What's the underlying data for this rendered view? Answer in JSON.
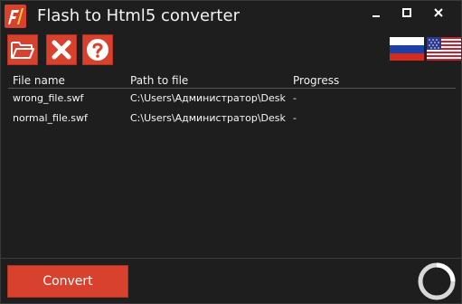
{
  "window": {
    "title": "Flash to Html5 converter",
    "logo_icon": "flash-converter-logo-icon",
    "controls": [
      "minimize-icon",
      "maximize-icon",
      "close-icon"
    ]
  },
  "toolbar": {
    "buttons": [
      {
        "icon": "folder-open-icon",
        "action": "open"
      },
      {
        "icon": "x-remove-icon",
        "action": "remove"
      },
      {
        "icon": "question-help-icon",
        "action": "help"
      }
    ],
    "languages": [
      "russian-flag-icon",
      "usa-flag-icon"
    ]
  },
  "table": {
    "columns": [
      "File name",
      "Path to file",
      "Progress"
    ],
    "rows": [
      {
        "file": "wrong_file.swf",
        "path": "C:\\Users\\Администратор\\Deskt",
        "progress": "-"
      },
      {
        "file": "normal_file.swf",
        "path": "C:\\Users\\Администратор\\Deskt",
        "progress": "-"
      }
    ]
  },
  "footer": {
    "convert_label": "Convert",
    "status_icon": "loading-ring-icon"
  },
  "colors": {
    "background": "#1e1e1e",
    "accent": "#d7412d",
    "text": "#ffffff"
  }
}
